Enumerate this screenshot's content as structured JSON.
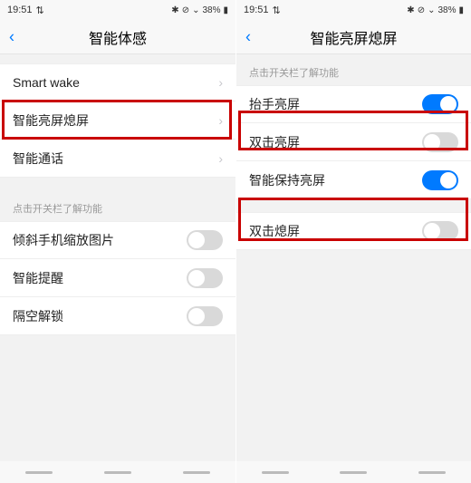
{
  "status": {
    "time": "19:51",
    "net_icon": "⇅",
    "bt_icon": "⋮",
    "alarm_icon": "⏰",
    "battery_pct": "38%",
    "wifi_icon": "📶",
    "battery_icon": "▮"
  },
  "left": {
    "title": "智能体感",
    "rows": {
      "smart_wake": "Smart wake",
      "smart_screen": "智能亮屏熄屏",
      "smart_call": "智能通话"
    },
    "hint": "点击开关栏了解功能",
    "toggles": {
      "tilt_zoom": "倾斜手机缩放图片",
      "smart_remind": "智能提醒",
      "air_unlock": "隔空解锁"
    }
  },
  "right": {
    "title": "智能亮屏熄屏",
    "hint": "点击开关栏了解功能",
    "toggles": {
      "raise_wake": {
        "label": "抬手亮屏",
        "state": "on"
      },
      "dbl_tap_wake": {
        "label": "双击亮屏",
        "state": "off"
      },
      "smart_keep_on": {
        "label": "智能保持亮屏",
        "state": "on"
      },
      "dbl_tap_sleep": {
        "label": "双击熄屏",
        "state": "off"
      }
    }
  }
}
